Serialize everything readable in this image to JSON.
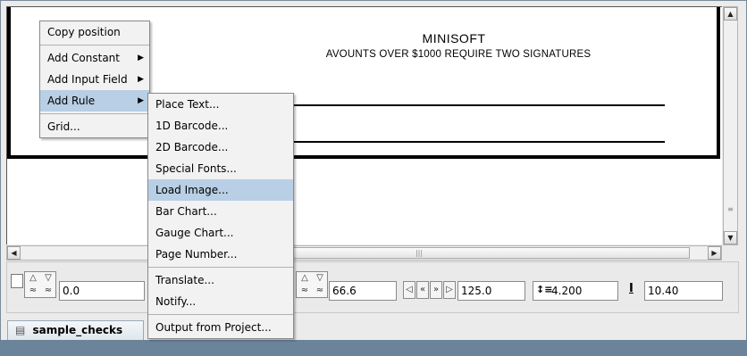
{
  "canvas": {
    "title": "MINISOFT",
    "subtitle": "AVOUNTS OVER $1000 REQUIRE TWO SIGNATURES"
  },
  "context_menu": {
    "items": [
      {
        "label": "Copy position",
        "submenu": false
      },
      {
        "label": "Add Constant",
        "submenu": true
      },
      {
        "label": "Add Input Field",
        "submenu": true
      },
      {
        "label": "Add Rule",
        "submenu": true,
        "highlighted": true
      },
      {
        "label": "Grid...",
        "submenu": false
      }
    ]
  },
  "submenu": {
    "items": [
      {
        "label": "Place Text..."
      },
      {
        "label": "1D Barcode..."
      },
      {
        "label": "2D Barcode..."
      },
      {
        "label": "Special Fonts..."
      },
      {
        "label": "Load Image...",
        "highlighted": true
      },
      {
        "label": "Bar Chart..."
      },
      {
        "label": "Gauge Chart..."
      },
      {
        "label": "Page Number..."
      },
      {
        "label": "Translate..."
      },
      {
        "label": "Notify..."
      },
      {
        "label": "Output from Project..."
      }
    ]
  },
  "toolbar": {
    "x_value": "0.0",
    "position_value": "66.6",
    "page_value": "125.0",
    "line_spacing_value": "4.200",
    "font_size_value": "10.40",
    "line_spacing_icon": "line-spacing-icon",
    "text-height-icon": "text-height-icon"
  },
  "tabs": [
    {
      "label": "sample_checks",
      "icon": "document-icon"
    }
  ],
  "colors": {
    "menu_highlight": "#b8cfe5",
    "bottom_bar": "#6c849a"
  }
}
